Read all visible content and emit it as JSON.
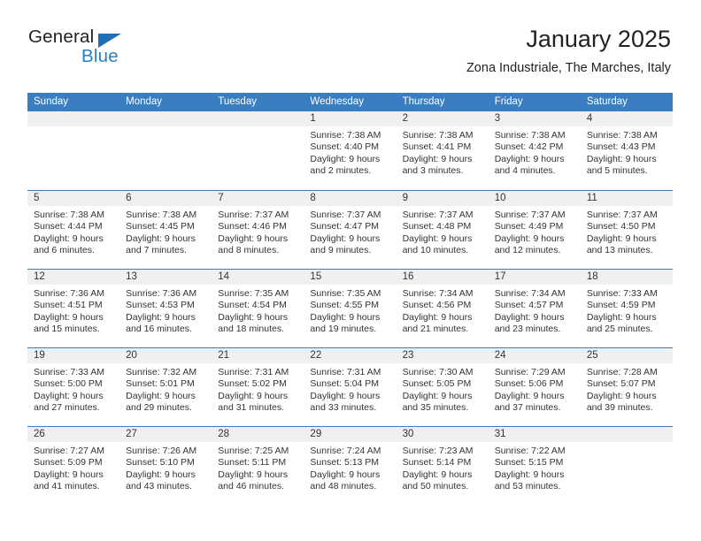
{
  "brand": {
    "word_general": "General",
    "word_blue": "Blue"
  },
  "header": {
    "title": "January 2025",
    "subtitle": "Zona Industriale, The Marches, Italy"
  },
  "colors": {
    "header_blue": "#3a7dc0",
    "brand_blue": "#2a7ec1",
    "day_band": "#f0f0f0",
    "text": "#333333"
  },
  "weekdays": [
    "Sunday",
    "Monday",
    "Tuesday",
    "Wednesday",
    "Thursday",
    "Friday",
    "Saturday"
  ],
  "labels": {
    "sunrise_prefix": "Sunrise:",
    "sunset_prefix": "Sunset:",
    "daylight_prefix": "Daylight:"
  },
  "weeks": [
    [
      {
        "day": "",
        "sunrise": "",
        "sunset": "",
        "daylight": ""
      },
      {
        "day": "",
        "sunrise": "",
        "sunset": "",
        "daylight": ""
      },
      {
        "day": "",
        "sunrise": "",
        "sunset": "",
        "daylight": ""
      },
      {
        "day": "1",
        "sunrise": "Sunrise: 7:38 AM",
        "sunset": "Sunset: 4:40 PM",
        "daylight": "Daylight: 9 hours and 2 minutes."
      },
      {
        "day": "2",
        "sunrise": "Sunrise: 7:38 AM",
        "sunset": "Sunset: 4:41 PM",
        "daylight": "Daylight: 9 hours and 3 minutes."
      },
      {
        "day": "3",
        "sunrise": "Sunrise: 7:38 AM",
        "sunset": "Sunset: 4:42 PM",
        "daylight": "Daylight: 9 hours and 4 minutes."
      },
      {
        "day": "4",
        "sunrise": "Sunrise: 7:38 AM",
        "sunset": "Sunset: 4:43 PM",
        "daylight": "Daylight: 9 hours and 5 minutes."
      }
    ],
    [
      {
        "day": "5",
        "sunrise": "Sunrise: 7:38 AM",
        "sunset": "Sunset: 4:44 PM",
        "daylight": "Daylight: 9 hours and 6 minutes."
      },
      {
        "day": "6",
        "sunrise": "Sunrise: 7:38 AM",
        "sunset": "Sunset: 4:45 PM",
        "daylight": "Daylight: 9 hours and 7 minutes."
      },
      {
        "day": "7",
        "sunrise": "Sunrise: 7:37 AM",
        "sunset": "Sunset: 4:46 PM",
        "daylight": "Daylight: 9 hours and 8 minutes."
      },
      {
        "day": "8",
        "sunrise": "Sunrise: 7:37 AM",
        "sunset": "Sunset: 4:47 PM",
        "daylight": "Daylight: 9 hours and 9 minutes."
      },
      {
        "day": "9",
        "sunrise": "Sunrise: 7:37 AM",
        "sunset": "Sunset: 4:48 PM",
        "daylight": "Daylight: 9 hours and 10 minutes."
      },
      {
        "day": "10",
        "sunrise": "Sunrise: 7:37 AM",
        "sunset": "Sunset: 4:49 PM",
        "daylight": "Daylight: 9 hours and 12 minutes."
      },
      {
        "day": "11",
        "sunrise": "Sunrise: 7:37 AM",
        "sunset": "Sunset: 4:50 PM",
        "daylight": "Daylight: 9 hours and 13 minutes."
      }
    ],
    [
      {
        "day": "12",
        "sunrise": "Sunrise: 7:36 AM",
        "sunset": "Sunset: 4:51 PM",
        "daylight": "Daylight: 9 hours and 15 minutes."
      },
      {
        "day": "13",
        "sunrise": "Sunrise: 7:36 AM",
        "sunset": "Sunset: 4:53 PM",
        "daylight": "Daylight: 9 hours and 16 minutes."
      },
      {
        "day": "14",
        "sunrise": "Sunrise: 7:35 AM",
        "sunset": "Sunset: 4:54 PM",
        "daylight": "Daylight: 9 hours and 18 minutes."
      },
      {
        "day": "15",
        "sunrise": "Sunrise: 7:35 AM",
        "sunset": "Sunset: 4:55 PM",
        "daylight": "Daylight: 9 hours and 19 minutes."
      },
      {
        "day": "16",
        "sunrise": "Sunrise: 7:34 AM",
        "sunset": "Sunset: 4:56 PM",
        "daylight": "Daylight: 9 hours and 21 minutes."
      },
      {
        "day": "17",
        "sunrise": "Sunrise: 7:34 AM",
        "sunset": "Sunset: 4:57 PM",
        "daylight": "Daylight: 9 hours and 23 minutes."
      },
      {
        "day": "18",
        "sunrise": "Sunrise: 7:33 AM",
        "sunset": "Sunset: 4:59 PM",
        "daylight": "Daylight: 9 hours and 25 minutes."
      }
    ],
    [
      {
        "day": "19",
        "sunrise": "Sunrise: 7:33 AM",
        "sunset": "Sunset: 5:00 PM",
        "daylight": "Daylight: 9 hours and 27 minutes."
      },
      {
        "day": "20",
        "sunrise": "Sunrise: 7:32 AM",
        "sunset": "Sunset: 5:01 PM",
        "daylight": "Daylight: 9 hours and 29 minutes."
      },
      {
        "day": "21",
        "sunrise": "Sunrise: 7:31 AM",
        "sunset": "Sunset: 5:02 PM",
        "daylight": "Daylight: 9 hours and 31 minutes."
      },
      {
        "day": "22",
        "sunrise": "Sunrise: 7:31 AM",
        "sunset": "Sunset: 5:04 PM",
        "daylight": "Daylight: 9 hours and 33 minutes."
      },
      {
        "day": "23",
        "sunrise": "Sunrise: 7:30 AM",
        "sunset": "Sunset: 5:05 PM",
        "daylight": "Daylight: 9 hours and 35 minutes."
      },
      {
        "day": "24",
        "sunrise": "Sunrise: 7:29 AM",
        "sunset": "Sunset: 5:06 PM",
        "daylight": "Daylight: 9 hours and 37 minutes."
      },
      {
        "day": "25",
        "sunrise": "Sunrise: 7:28 AM",
        "sunset": "Sunset: 5:07 PM",
        "daylight": "Daylight: 9 hours and 39 minutes."
      }
    ],
    [
      {
        "day": "26",
        "sunrise": "Sunrise: 7:27 AM",
        "sunset": "Sunset: 5:09 PM",
        "daylight": "Daylight: 9 hours and 41 minutes."
      },
      {
        "day": "27",
        "sunrise": "Sunrise: 7:26 AM",
        "sunset": "Sunset: 5:10 PM",
        "daylight": "Daylight: 9 hours and 43 minutes."
      },
      {
        "day": "28",
        "sunrise": "Sunrise: 7:25 AM",
        "sunset": "Sunset: 5:11 PM",
        "daylight": "Daylight: 9 hours and 46 minutes."
      },
      {
        "day": "29",
        "sunrise": "Sunrise: 7:24 AM",
        "sunset": "Sunset: 5:13 PM",
        "daylight": "Daylight: 9 hours and 48 minutes."
      },
      {
        "day": "30",
        "sunrise": "Sunrise: 7:23 AM",
        "sunset": "Sunset: 5:14 PM",
        "daylight": "Daylight: 9 hours and 50 minutes."
      },
      {
        "day": "31",
        "sunrise": "Sunrise: 7:22 AM",
        "sunset": "Sunset: 5:15 PM",
        "daylight": "Daylight: 9 hours and 53 minutes."
      },
      {
        "day": "",
        "sunrise": "",
        "sunset": "",
        "daylight": ""
      }
    ]
  ]
}
